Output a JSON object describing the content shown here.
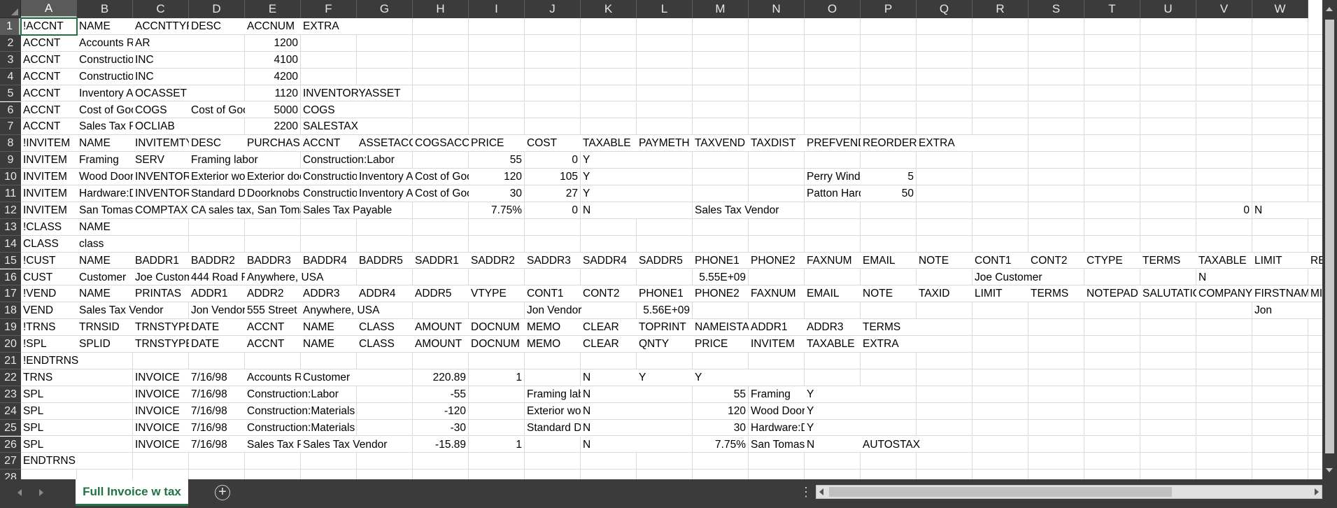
{
  "sheet": {
    "columns": [
      "A",
      "B",
      "C",
      "D",
      "E",
      "F",
      "G",
      "H",
      "I",
      "J",
      "K",
      "L",
      "M",
      "N",
      "O",
      "P",
      "Q",
      "R",
      "S",
      "T",
      "U",
      "V",
      "W"
    ],
    "selected_column": "A",
    "selected_row": 1,
    "rows": [
      {
        "n": 1,
        "cells": {
          "A": "!ACCNT",
          "B": "NAME",
          "C": "ACCNTTYPE",
          "D": "DESC",
          "E": "ACCNUM",
          "F": "EXTRA"
        }
      },
      {
        "n": 2,
        "cells": {
          "A": "ACCNT",
          "B": "Accounts Receivable",
          "C": "AR",
          "E": "1200"
        }
      },
      {
        "n": 3,
        "cells": {
          "A": "ACCNT",
          "B": "Construction:Labor",
          "C": "INC",
          "E": "4100"
        }
      },
      {
        "n": 4,
        "cells": {
          "A": "ACCNT",
          "B": "Construction:Materials",
          "C": "INC",
          "E": "4200"
        }
      },
      {
        "n": 5,
        "cells": {
          "A": "ACCNT",
          "B": "Inventory Asset",
          "C": "OCASSET",
          "E": "1120",
          "F": "INVENTORYASSET"
        }
      },
      {
        "n": 6,
        "cells": {
          "A": "ACCNT",
          "B": "Cost of Goods Sold",
          "C": "COGS",
          "D": "Cost of Goods Sold",
          "E": "5000",
          "F": "COGS"
        }
      },
      {
        "n": 7,
        "cells": {
          "A": "ACCNT",
          "B": "Sales Tax Payable",
          "C": "OCLIAB",
          "E": "2200",
          "F": "SALESTAX"
        }
      },
      {
        "n": 8,
        "cells": {
          "A": "!INVITEM",
          "B": "NAME",
          "C": "INVITEMTYPE",
          "D": "DESC",
          "E": "PURCHASEDESC",
          "F": "ACCNT",
          "G": "ASSETACCNT",
          "H": "COGSACCNT",
          "I": "PRICE",
          "J": "COST",
          "K": "TAXABLE",
          "L": "PAYMETH",
          "M": "TAXVEND",
          "N": "TAXDIST",
          "O": "PREFVEND",
          "P": "REORDERPOINT",
          "Q": "EXTRA"
        }
      },
      {
        "n": 9,
        "cells": {
          "A": "INVITEM",
          "B": "Framing",
          "C": "SERV",
          "D": "Framing labor",
          "F": "Construction:Labor",
          "I": "55",
          "J": "0",
          "K": "Y"
        }
      },
      {
        "n": 10,
        "cells": {
          "A": "INVITEM",
          "B": "Wood Door",
          "C": "INVENTORY",
          "D": "Exterior wood door",
          "E": "Exterior door",
          "F": "Construction:Materials",
          "G": "Inventory Asset",
          "H": "Cost of Goods Sold",
          "I": "120",
          "J": "105",
          "K": "Y",
          "O": "Perry Windows & Doors",
          "P": "5"
        }
      },
      {
        "n": 11,
        "cells": {
          "A": "INVITEM",
          "B": "Hardware:Doorknobs",
          "C": "INVENTORY",
          "D": "Standard Doorknobs",
          "E": "Doorknobs",
          "F": "Construction:Materials",
          "G": "Inventory Asset",
          "H": "Cost of Goods Sold",
          "I": "30",
          "J": "27",
          "K": "Y",
          "O": "Patton Hardware",
          "P": "50"
        }
      },
      {
        "n": 12,
        "cells": {
          "A": "INVITEM",
          "B": "San Tomas",
          "C": "COMPTAX",
          "D": "CA sales tax, San Tomas",
          "F": "Sales Tax Payable",
          "I": "7.75%",
          "J": "0",
          "K": "N",
          "M": "Sales Tax Vendor",
          "V": "0",
          "W": "N"
        }
      },
      {
        "n": 13,
        "cells": {
          "A": "!CLASS",
          "B": "NAME"
        }
      },
      {
        "n": 14,
        "cells": {
          "A": "CLASS",
          "B": "class"
        }
      },
      {
        "n": 15,
        "cells": {
          "A": "!CUST",
          "B": "NAME",
          "C": "BADDR1",
          "D": "BADDR2",
          "E": "BADDR3",
          "F": "BADDR4",
          "G": "BADDR5",
          "H": "SADDR1",
          "I": "SADDR2",
          "J": "SADDR3",
          "K": "SADDR4",
          "L": "SADDR5",
          "M": "PHONE1",
          "N": "PHONE2",
          "O": "FAXNUM",
          "P": "EMAIL",
          "Q": "NOTE",
          "R": "CONT1",
          "S": "CONT2",
          "T": "CTYPE",
          "U": "TERMS",
          "V": "TAXABLE",
          "W": "LIMIT",
          "X": "RESALENUM"
        }
      },
      {
        "n": 16,
        "cells": {
          "A": "CUST",
          "B": "Customer",
          "C": "Joe Customer",
          "D": "444 Road Rd",
          "E": "Anywhere, USA",
          "M": "5.55E+09",
          "R": "Joe Customer",
          "V": "N"
        }
      },
      {
        "n": 17,
        "cells": {
          "A": "!VEND",
          "B": "NAME",
          "C": "PRINTAS",
          "D": "ADDR1",
          "E": "ADDR2",
          "F": "ADDR3",
          "G": "ADDR4",
          "H": "ADDR5",
          "I": "VTYPE",
          "J": "CONT1",
          "K": "CONT2",
          "L": "PHONE1",
          "M": "PHONE2",
          "N": "FAXNUM",
          "O": "EMAIL",
          "P": "NOTE",
          "Q": "TAXID",
          "R": "LIMIT",
          "S": "TERMS",
          "T": "NOTEPAD",
          "U": "SALUTATION",
          "V": "COMPANYNAME",
          "W": "FIRSTNAME",
          "X": "MIDINIT"
        }
      },
      {
        "n": 18,
        "cells": {
          "A": "VEND",
          "B": "Sales Tax Vendor",
          "D": "Jon Vendor",
          "E": "555 Street Rd",
          "F": "Anywhere, USA",
          "J": "Jon Vendor",
          "L": "5.56E+09",
          "W": "Jon"
        }
      },
      {
        "n": 19,
        "cells": {
          "A": "!TRNS",
          "B": "TRNSID",
          "C": "TRNSTYPE",
          "D": "DATE",
          "E": "ACCNT",
          "F": "NAME",
          "G": "CLASS",
          "H": "AMOUNT",
          "I": "DOCNUM",
          "J": "MEMO",
          "K": "CLEAR",
          "L": "TOPRINT",
          "M": "NAMEISTAXABLE",
          "N": "ADDR1",
          "O": "ADDR3",
          "P": "TERMS"
        }
      },
      {
        "n": 20,
        "cells": {
          "A": "!SPL",
          "B": "SPLID",
          "C": "TRNSTYPE",
          "D": "DATE",
          "E": "ACCNT",
          "F": "NAME",
          "G": "CLASS",
          "H": "AMOUNT",
          "I": "DOCNUM",
          "J": "MEMO",
          "K": "CLEAR",
          "L": "QNTY",
          "M": "PRICE",
          "N": "INVITEM",
          "O": "TAXABLE",
          "P": "EXTRA"
        }
      },
      {
        "n": 21,
        "cells": {
          "A": "!ENDTRNS"
        }
      },
      {
        "n": 22,
        "cells": {
          "A": "TRNS",
          "C": "INVOICE",
          "D": "7/16/98",
          "E": "Accounts Receivable",
          "F": "Customer",
          "H": "220.89",
          "I": "1",
          "K": "N",
          "L": "Y",
          "M": "Y"
        }
      },
      {
        "n": 23,
        "cells": {
          "A": "SPL",
          "C": "INVOICE",
          "D": "7/16/98",
          "E": "Construction:Labor",
          "H": "-55",
          "J": "Framing labor",
          "K": "N",
          "M": "55",
          "N": "Framing",
          "O": "Y"
        }
      },
      {
        "n": 24,
        "cells": {
          "A": "SPL",
          "C": "INVOICE",
          "D": "7/16/98",
          "E": "Construction:Materials",
          "H": "-120",
          "J": "Exterior wood door",
          "K": "N",
          "M": "120",
          "N": "Wood Door",
          "O": "Y"
        }
      },
      {
        "n": 25,
        "cells": {
          "A": "SPL",
          "C": "INVOICE",
          "D": "7/16/98",
          "E": "Construction:Materials",
          "H": "-30",
          "J": "Standard Doorknobs",
          "K": "N",
          "M": "30",
          "N": "Hardware:Doorknobs",
          "O": "Y"
        }
      },
      {
        "n": 26,
        "cells": {
          "A": "SPL",
          "C": "INVOICE",
          "D": "7/16/98",
          "E": "Sales Tax Payable",
          "F": "Sales Tax Vendor",
          "H": "-15.89",
          "I": "1",
          "K": "N",
          "M": "7.75%",
          "N": "San Tomas",
          "O": "N",
          "P": "AUTOSTAX"
        }
      },
      {
        "n": 27,
        "cells": {
          "A": "ENDTRNS"
        }
      },
      {
        "n": 28,
        "cells": {}
      }
    ]
  },
  "tabs": {
    "active": "Full Invoice w tax",
    "add_label": "+",
    "more_label": "⋮"
  },
  "icons": {
    "prev_sheet": "chevron-left-icon",
    "next_sheet": "chevron-right-icon",
    "add_sheet": "plus-circle-icon"
  },
  "colors": {
    "accent": "#217346",
    "header_bg": "#3b3b3b",
    "gridline": "#dadada"
  }
}
